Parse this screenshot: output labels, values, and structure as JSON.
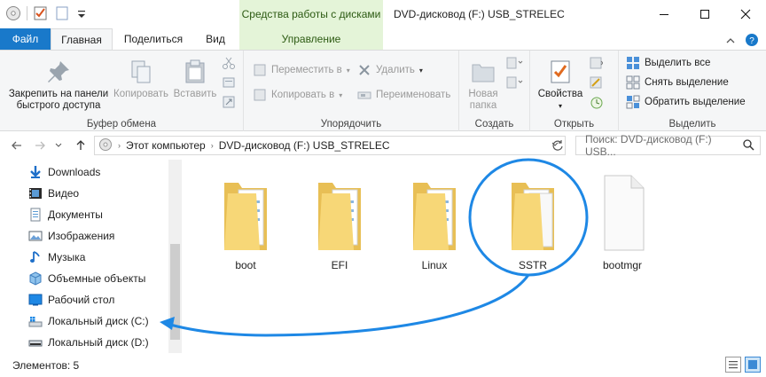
{
  "window": {
    "contextual_tab_title": "Средства работы с дисками",
    "title": "DVD-дисковод (F:) USB_STRELEC"
  },
  "tabs": {
    "file": "Файл",
    "home": "Главная",
    "share": "Поделиться",
    "view": "Вид",
    "manage": "Управление"
  },
  "ribbon": {
    "clipboard": {
      "label": "Буфер обмена",
      "pin": "Закрепить на панели быстрого доступа",
      "pin_line1": "Закрепить на панели",
      "pin_line2": "быстрого доступа",
      "copy": "Копировать",
      "paste": "Вставить"
    },
    "organize": {
      "label": "Упорядочить",
      "move_to": "Переместить в",
      "copy_to": "Копировать в",
      "delete": "Удалить",
      "rename": "Переименовать"
    },
    "create": {
      "label": "Создать",
      "new_folder_line1": "Новая",
      "new_folder_line2": "папка"
    },
    "open": {
      "label": "Открыть",
      "properties": "Свойства"
    },
    "select": {
      "label": "Выделить",
      "select_all": "Выделить все",
      "select_none": "Снять выделение",
      "invert": "Обратить выделение"
    }
  },
  "address": {
    "crumbs": [
      "Этот компьютер",
      "DVD-дисковод (F:) USB_STRELEC"
    ],
    "search_placeholder": "Поиск: DVD-дисковод (F:) USB..."
  },
  "nav": {
    "items": [
      {
        "label": "Downloads",
        "icon": "download-arrow-icon"
      },
      {
        "label": "Видео",
        "icon": "video-icon"
      },
      {
        "label": "Документы",
        "icon": "document-icon"
      },
      {
        "label": "Изображения",
        "icon": "image-icon"
      },
      {
        "label": "Музыка",
        "icon": "music-note-icon"
      },
      {
        "label": "Объемные объекты",
        "icon": "cube-icon"
      },
      {
        "label": "Рабочий стол",
        "icon": "desktop-icon"
      },
      {
        "label": "Локальный диск (C:)",
        "icon": "windows-drive-icon"
      },
      {
        "label": "Локальный диск (D:)",
        "icon": "drive-icon"
      }
    ]
  },
  "files": [
    {
      "name": "boot",
      "type": "folder"
    },
    {
      "name": "EFI",
      "type": "folder"
    },
    {
      "name": "Linux",
      "type": "folder"
    },
    {
      "name": "SSTR",
      "type": "folder"
    },
    {
      "name": "bootmgr",
      "type": "file"
    }
  ],
  "status": {
    "count": "Элементов: 5"
  },
  "colors": {
    "accent": "#1979ca",
    "contextual": "#e4f4d8",
    "annotation": "#1e88e5",
    "folder": "#f7d777"
  }
}
